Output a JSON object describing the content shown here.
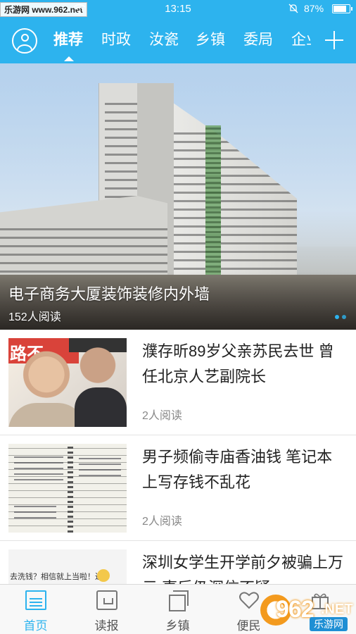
{
  "status_bar": {
    "watermark": "乐游网 www.962.net",
    "time": "13:15",
    "battery_percent": "87%",
    "battery_level": 0.87
  },
  "nav": {
    "tabs": [
      {
        "label": "推荐",
        "active": true
      },
      {
        "label": "时政",
        "active": false
      },
      {
        "label": "汝瓷",
        "active": false
      },
      {
        "label": "乡镇",
        "active": false
      },
      {
        "label": "委局",
        "active": false
      },
      {
        "label": "企业",
        "active": false
      }
    ]
  },
  "banner": {
    "title": "电子商务大厦装饰装修内外墙",
    "reads": "152人阅读",
    "page_count": 2,
    "active_page": 1
  },
  "news": [
    {
      "title": "濮存昕89岁父亲苏民去世 曾任北京人艺副院长",
      "reads": "2人阅读",
      "thumb_text": "路不"
    },
    {
      "title": "男子频偷寺庙香油钱 笔记本上写存钱不乱花",
      "reads": "2人阅读"
    },
    {
      "title": "深圳女学生开学前夕被骗上万元 事后仍深信不疑",
      "reads": "",
      "thumb_text": "去洗钱？相信就上当啦！近"
    }
  ],
  "bottom_tabs": [
    {
      "label": "首页",
      "icon": "news-icon",
      "active": true
    },
    {
      "label": "读报",
      "icon": "newspaper-icon",
      "active": false
    },
    {
      "label": "乡镇",
      "icon": "stack-icon",
      "active": false
    },
    {
      "label": "便民",
      "icon": "heart-icon",
      "active": false
    },
    {
      "label": "",
      "icon": "gift-icon",
      "active": false
    }
  ],
  "logo": {
    "number": "962",
    "domain": ".NET",
    "subtitle": "乐游网"
  },
  "colors": {
    "accent": "#2db3ee",
    "text": "#222222",
    "muted": "#888888"
  }
}
